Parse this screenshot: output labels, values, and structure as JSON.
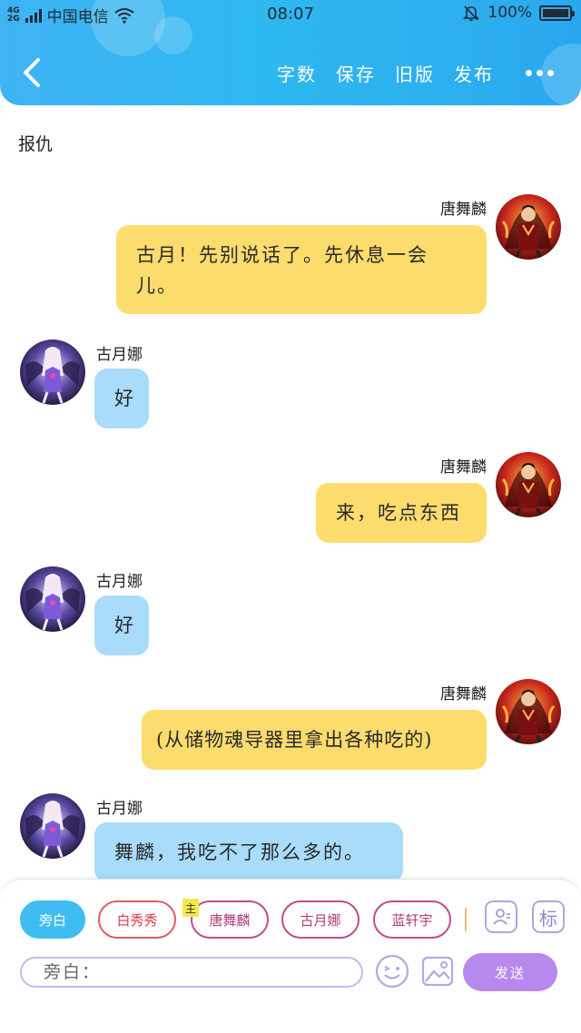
{
  "status_bar": {
    "network_top": "4G",
    "network_bottom": "2G",
    "carrier": "中国电信",
    "time": "08:07",
    "battery": "100%",
    "battery_level": 1.0
  },
  "header": {
    "back_icon": "chevron-left-icon",
    "actions": [
      "字数",
      "保存",
      "旧版",
      "发布"
    ],
    "more_icon": "more-dots-icon",
    "accent": "#2fb5f1"
  },
  "story": {
    "title": "报仇"
  },
  "messages": [
    {
      "side": "right",
      "name": "唐舞麟",
      "text": "古月！先别说话了。先休息一会儿。",
      "bubble_color": "#fddc6e"
    },
    {
      "side": "left",
      "name": "古月娜",
      "text": "好",
      "bubble_color": "#a9dcfa"
    },
    {
      "side": "right",
      "name": "唐舞麟",
      "text": "来，吃点东西",
      "bubble_color": "#fddc6e"
    },
    {
      "side": "left",
      "name": "古月娜",
      "text": "好",
      "bubble_color": "#a9dcfa"
    },
    {
      "side": "right",
      "name": "唐舞麟",
      "text": "(从储物魂导器里拿出各种吃的)",
      "bubble_color": "#fddc6e"
    },
    {
      "side": "left",
      "name": "古月娜",
      "text": "舞麟，我吃不了那么多的。",
      "bubble_color": "#a9dcfa"
    }
  ],
  "roles": {
    "items": [
      "旁白",
      "白秀秀",
      "唐舞麟",
      "古月娜",
      "蓝轩宇"
    ],
    "selected": "旁白",
    "main_badge": "主",
    "contact_icon": "contact-card-icon",
    "tag_label": "标"
  },
  "composer": {
    "placeholder": "旁白：",
    "emoji_icon": "emoji-icon",
    "image_icon": "image-icon",
    "send_label": "发送",
    "send_color": "#b889ec"
  }
}
